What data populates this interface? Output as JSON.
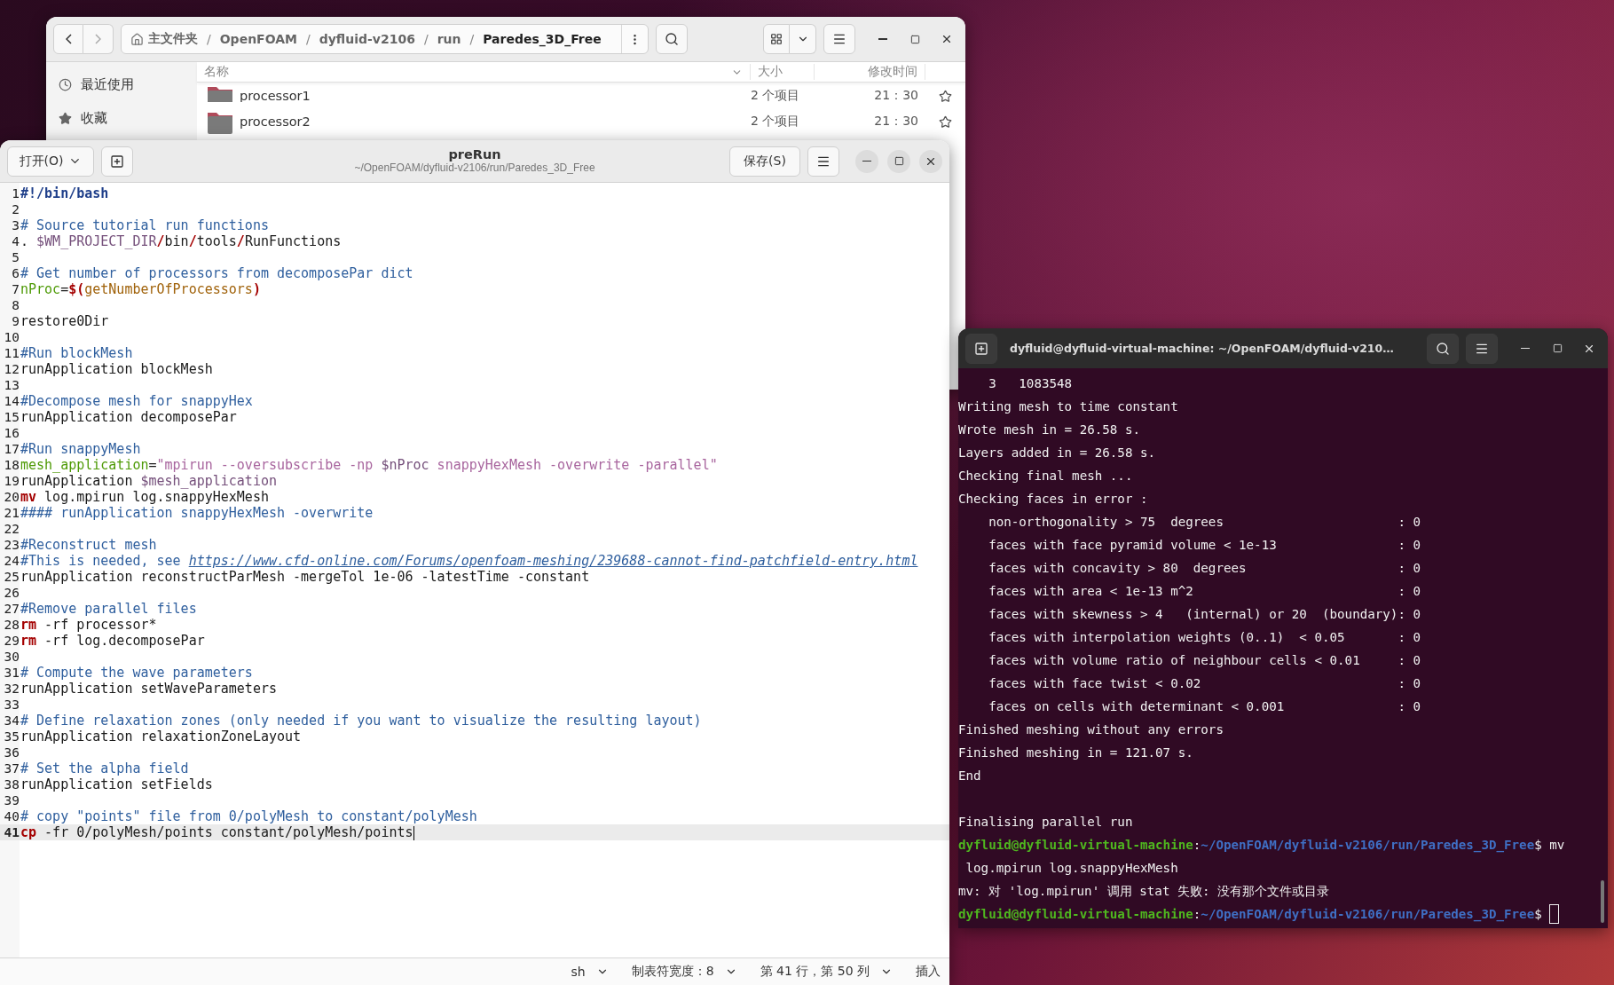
{
  "file_manager": {
    "nav": {
      "back_disabled": false,
      "forward_disabled": true
    },
    "path": {
      "separator": "/",
      "crumbs": [
        {
          "label": "主文件夹",
          "home": true,
          "selected": false
        },
        {
          "label": "OpenFOAM",
          "home": false,
          "selected": false
        },
        {
          "label": "dyfluid-v2106",
          "home": false,
          "selected": false
        },
        {
          "label": "run",
          "home": false,
          "selected": false
        },
        {
          "label": "Paredes_3D_Free",
          "home": false,
          "selected": true
        }
      ]
    },
    "sidebar": [
      {
        "label": "最近使用"
      },
      {
        "label": "收藏"
      }
    ],
    "columns": [
      "名称",
      "大小",
      "修改时间"
    ],
    "rows": [
      {
        "name": "processor1",
        "size": "2 个项目",
        "time": "21：30",
        "starred": false
      },
      {
        "name": "processor2",
        "size": "2 个项目",
        "time": "21：30",
        "starred": false
      }
    ]
  },
  "editor": {
    "title": "preRun",
    "subtitle": "~/OpenFOAM/dyfluid-v2106/run/Paredes_3D_Free",
    "open_button": "打开(O)",
    "save_button": "保存(S)",
    "lines": [
      {
        "number": "1",
        "current": false,
        "tokens": [
          {
            "kind": "shebang",
            "text": "#!/bin/bash"
          }
        ]
      },
      {
        "number": "2",
        "current": false
      },
      {
        "number": "3",
        "current": false,
        "tokens": [
          {
            "kind": "comment",
            "text": "# Source tutorial run functions"
          }
        ]
      },
      {
        "number": "4",
        "current": false,
        "tokens": [
          {
            "kind": "plain",
            "text": ". "
          },
          {
            "kind": "variable",
            "text": "$WM_PROJECT_DIR"
          },
          {
            "kind": "operator",
            "text": "/"
          },
          {
            "kind": "plain",
            "text": "bin"
          },
          {
            "kind": "operator",
            "text": "/"
          },
          {
            "kind": "plain",
            "text": "tools"
          },
          {
            "kind": "operator",
            "text": "/"
          },
          {
            "kind": "plain",
            "text": "RunFunctions"
          }
        ]
      },
      {
        "number": "5",
        "current": false
      },
      {
        "number": "6",
        "current": false,
        "tokens": [
          {
            "kind": "comment",
            "text": "# Get number of processors from decomposePar dict"
          }
        ]
      },
      {
        "number": "7",
        "current": false,
        "tokens": [
          {
            "kind": "assign",
            "text": "nProc"
          },
          {
            "kind": "plain",
            "text": "="
          },
          {
            "kind": "operator",
            "text": "$("
          },
          {
            "kind": "substitution",
            "text": "getNumberOfProcessors"
          },
          {
            "kind": "operator",
            "text": ")"
          }
        ]
      },
      {
        "number": "8",
        "current": false
      },
      {
        "number": "9",
        "current": false,
        "tokens": [
          {
            "kind": "plain",
            "text": "restore0Dir"
          }
        ]
      },
      {
        "number": "10",
        "current": false
      },
      {
        "number": "11",
        "current": false,
        "tokens": [
          {
            "kind": "comment",
            "text": "#Run blockMesh"
          }
        ]
      },
      {
        "number": "12",
        "current": false,
        "tokens": [
          {
            "kind": "plain",
            "text": "runApplication blockMesh"
          }
        ]
      },
      {
        "number": "13",
        "current": false
      },
      {
        "number": "14",
        "current": false,
        "tokens": [
          {
            "kind": "comment",
            "text": "#Decompose mesh for snappyHex"
          }
        ]
      },
      {
        "number": "15",
        "current": false,
        "tokens": [
          {
            "kind": "plain",
            "text": "runApplication decomposePar"
          }
        ]
      },
      {
        "number": "16",
        "current": false
      },
      {
        "number": "17",
        "current": false,
        "tokens": [
          {
            "kind": "comment",
            "text": "#Run snappyMesh"
          }
        ]
      },
      {
        "number": "18",
        "current": false,
        "tokens": [
          {
            "kind": "assign",
            "text": "mesh_application"
          },
          {
            "kind": "plain",
            "text": "="
          },
          {
            "kind": "string",
            "text": "\"mpirun --oversubscribe -np "
          },
          {
            "kind": "variable",
            "text": "$nProc"
          },
          {
            "kind": "string",
            "text": " snappyHexMesh -overwrite -parallel\""
          }
        ]
      },
      {
        "number": "19",
        "current": false,
        "tokens": [
          {
            "kind": "plain",
            "text": "runApplication "
          },
          {
            "kind": "variable",
            "text": "$mesh_application"
          }
        ]
      },
      {
        "number": "20",
        "current": false,
        "tokens": [
          {
            "kind": "command",
            "text": "mv"
          },
          {
            "kind": "plain",
            "text": " log.mpirun log.snappyHexMesh"
          }
        ]
      },
      {
        "number": "21",
        "current": false,
        "tokens": [
          {
            "kind": "comment",
            "text": "#### runApplication snappyHexMesh -overwrite"
          }
        ]
      },
      {
        "number": "22",
        "current": false
      },
      {
        "number": "23",
        "current": false,
        "tokens": [
          {
            "kind": "comment",
            "text": "#Reconstruct mesh"
          }
        ]
      },
      {
        "number": "24",
        "current": false,
        "tokens": [
          {
            "kind": "comment",
            "text": "#This is needed, see "
          },
          {
            "kind": "link",
            "text": "https://www.cfd-online.com/Forums/openfoam-meshing/239688-cannot-find-patchfield-entry.html"
          }
        ]
      },
      {
        "number": "25",
        "current": false,
        "tokens": [
          {
            "kind": "plain",
            "text": "runApplication reconstructParMesh -mergeTol 1e-06 -latestTime -constant"
          }
        ]
      },
      {
        "number": "26",
        "current": false
      },
      {
        "number": "27",
        "current": false,
        "tokens": [
          {
            "kind": "comment",
            "text": "#Remove parallel files"
          }
        ]
      },
      {
        "number": "28",
        "current": false,
        "tokens": [
          {
            "kind": "command",
            "text": "rm"
          },
          {
            "kind": "plain",
            "text": " -rf processor*"
          }
        ]
      },
      {
        "number": "29",
        "current": false,
        "tokens": [
          {
            "kind": "command",
            "text": "rm"
          },
          {
            "kind": "plain",
            "text": " -rf log.decomposePar"
          }
        ]
      },
      {
        "number": "30",
        "current": false
      },
      {
        "number": "31",
        "current": false,
        "tokens": [
          {
            "kind": "comment",
            "text": "# Compute the wave parameters"
          }
        ]
      },
      {
        "number": "32",
        "current": false,
        "tokens": [
          {
            "kind": "plain",
            "text": "runApplication setWaveParameters"
          }
        ]
      },
      {
        "number": "33",
        "current": false
      },
      {
        "number": "34",
        "current": false,
        "tokens": [
          {
            "kind": "comment",
            "text": "# Define relaxation zones (only needed if you want to visualize the resulting layout)"
          }
        ]
      },
      {
        "number": "35",
        "current": false,
        "tokens": [
          {
            "kind": "plain",
            "text": "runApplication relaxationZoneLayout"
          }
        ]
      },
      {
        "number": "36",
        "current": false
      },
      {
        "number": "37",
        "current": false,
        "tokens": [
          {
            "kind": "comment",
            "text": "# Set the alpha field"
          }
        ]
      },
      {
        "number": "38",
        "current": false,
        "tokens": [
          {
            "kind": "plain",
            "text": "runApplication setFields"
          }
        ]
      },
      {
        "number": "39",
        "current": false
      },
      {
        "number": "40",
        "current": false,
        "tokens": [
          {
            "kind": "comment",
            "text": "# copy \"points\" file from 0/polyMesh to constant/polyMesh"
          }
        ]
      },
      {
        "number": "41",
        "current": true,
        "tokens": [
          {
            "kind": "command",
            "text": "cp"
          },
          {
            "kind": "plain",
            "text": " -fr 0/polyMesh/points constant/polyMesh/points"
          }
        ]
      }
    ],
    "status": [
      {
        "label": "sh",
        "dropdown": true
      },
      {
        "label": "制表符宽度：8",
        "dropdown": true
      },
      {
        "label": "第 41 行，第 50 列",
        "dropdown": true
      },
      {
        "label": "插入",
        "dropdown": false
      }
    ]
  },
  "terminal": {
    "title": "dyfluid@dyfluid-virtual-machine: ~/OpenFOAM/dyfluid-v210…",
    "lines": [
      {
        "kind": "output",
        "text": "    3   1083548"
      },
      {
        "kind": "output",
        "text": "Writing mesh to time constant"
      },
      {
        "kind": "output",
        "text": "Wrote mesh in = 26.58 s."
      },
      {
        "kind": "output",
        "text": "Layers added in = 26.58 s."
      },
      {
        "kind": "output",
        "text": "Checking final mesh ..."
      },
      {
        "kind": "output",
        "text": "Checking faces in error :"
      },
      {
        "kind": "check",
        "label": "non-orthogonality > 75  degrees",
        "value": ": 0"
      },
      {
        "kind": "check",
        "label": "faces with face pyramid volume < 1e-13",
        "value": ": 0"
      },
      {
        "kind": "check",
        "label": "faces with concavity > 80  degrees",
        "value": ": 0"
      },
      {
        "kind": "check",
        "label": "faces with area < 1e-13 m^2",
        "value": ": 0"
      },
      {
        "kind": "check",
        "label": "faces with skewness > 4   (internal) or 20  (boundary)",
        "value": ": 0"
      },
      {
        "kind": "check",
        "label": "faces with interpolation weights (0..1)  < 0.05",
        "value": ": 0"
      },
      {
        "kind": "check",
        "label": "faces with volume ratio of neighbour cells < 0.01",
        "value": ": 0"
      },
      {
        "kind": "check",
        "label": "faces with face twist < 0.02",
        "value": ": 0"
      },
      {
        "kind": "check",
        "label": "faces on cells with determinant < 0.001",
        "value": ": 0"
      },
      {
        "kind": "output",
        "text": "Finished meshing without any errors"
      },
      {
        "kind": "output",
        "text": "Finished meshing in = 121.07 s."
      },
      {
        "kind": "output",
        "text": "End"
      },
      {
        "kind": "blank"
      },
      {
        "kind": "output",
        "text": "Finalising parallel run"
      },
      {
        "kind": "prompt",
        "user": "dyfluid@dyfluid-virtual-machine",
        "sep": ":",
        "path": "~/OpenFOAM/dyfluid-v2106/run/Paredes_3D_Free",
        "command": "$ mv",
        "cursor": false
      },
      {
        "kind": "output",
        "text": " log.mpirun log.snappyHexMesh"
      },
      {
        "kind": "output",
        "text": "mv: 对 'log.mpirun' 调用 stat 失败: 没有那个文件或目录"
      },
      {
        "kind": "prompt",
        "user": "dyfluid@dyfluid-virtual-machine",
        "sep": ":",
        "path": "~/OpenFOAM/dyfluid-v2106/run/Paredes_3D_Free",
        "command": "$",
        "cursor": true
      }
    ]
  }
}
